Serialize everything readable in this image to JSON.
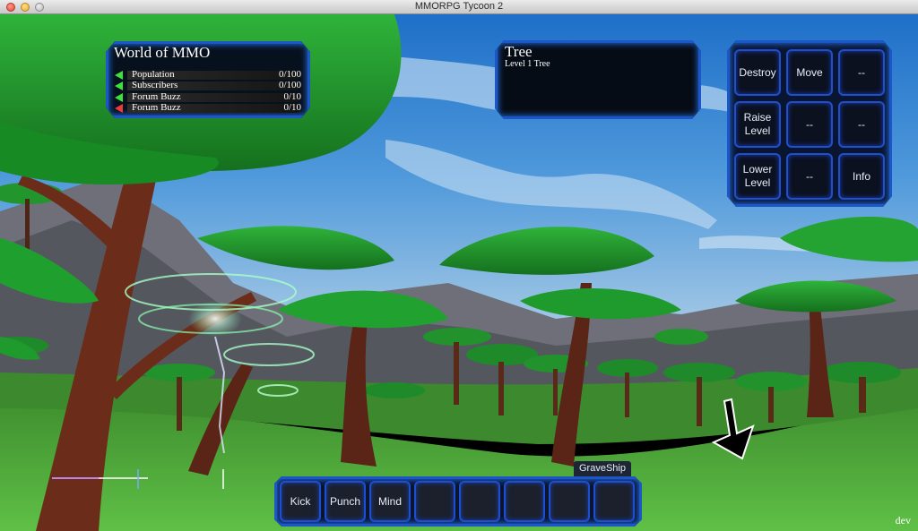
{
  "window": {
    "title": "MMORPG Tycoon 2"
  },
  "world_panel": {
    "title": "World of MMO",
    "stats": [
      {
        "label": "Population",
        "value": "0/100",
        "trend": "up",
        "color": "#3ee03e"
      },
      {
        "label": "Subscribers",
        "value": "0/100",
        "trend": "up",
        "color": "#3ee03e"
      },
      {
        "label": "Forum Buzz",
        "value": "0/10",
        "trend": "up",
        "color": "#3ee03e"
      },
      {
        "label": "Forum Buzz",
        "value": "0/10",
        "trend": "down",
        "color": "#f03a3a"
      }
    ]
  },
  "selection": {
    "title": "Tree",
    "subtitle": "Level 1 Tree"
  },
  "actions": {
    "destroy": "Destroy",
    "move": "Move",
    "empty": "--",
    "raise_level": "Raise Level",
    "lower_level": "Lower Level",
    "info": "Info"
  },
  "hotbar": {
    "player_name": "GraveShip",
    "slots": [
      "Kick",
      "Punch",
      "Mind",
      "",
      "",
      "",
      "",
      ""
    ]
  },
  "footer": {
    "mode": "dev"
  },
  "colors": {
    "panel_border": "#1b57c8",
    "panel_glow": "#2a7bff",
    "grass": "#4fa83a",
    "sky": "#2f7fd0"
  }
}
